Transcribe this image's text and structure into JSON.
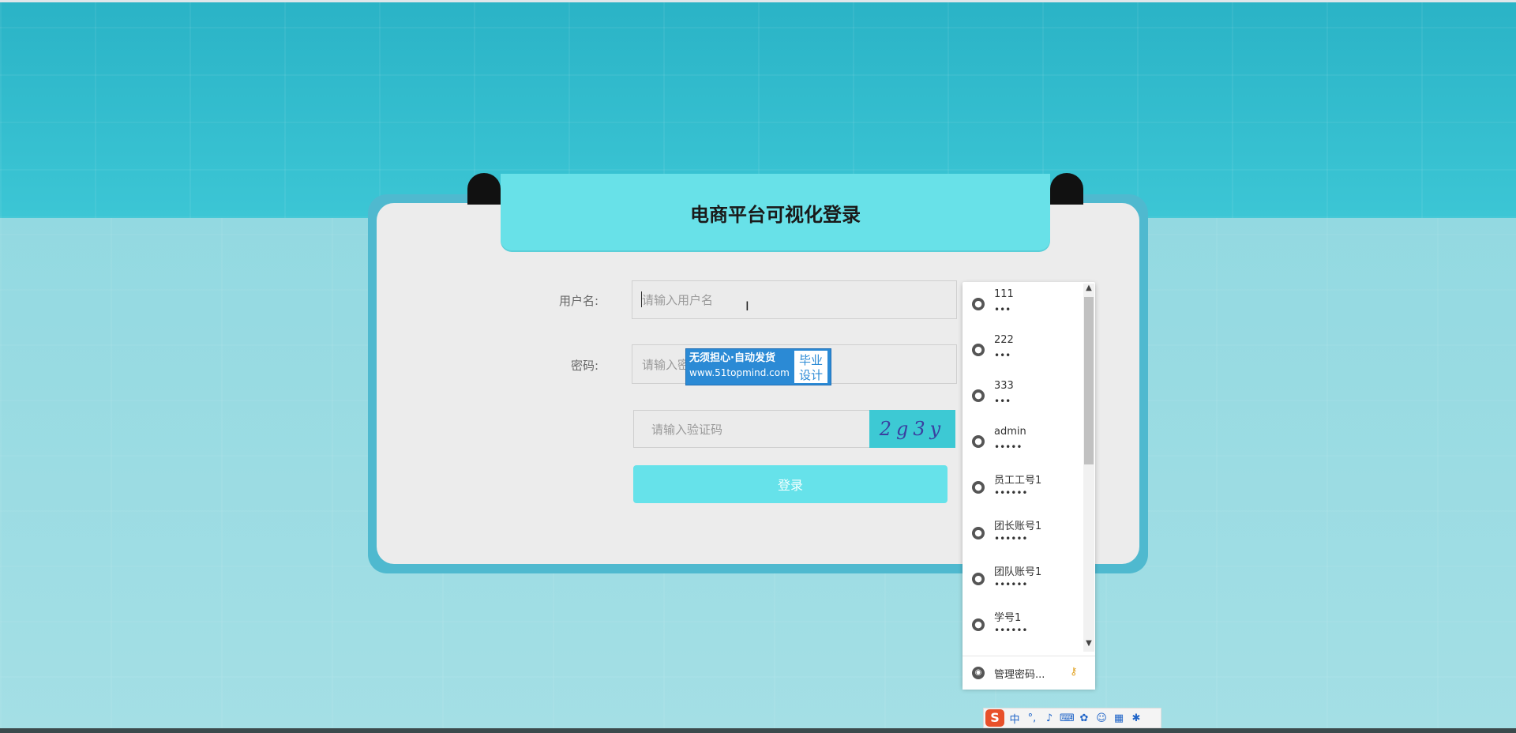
{
  "page": {
    "title": "电商平台可视化登录"
  },
  "form": {
    "username_label": "用户名:",
    "username_placeholder": "请输入用户名",
    "password_label": "密码:",
    "password_placeholder": "请输入密",
    "captcha_placeholder": "请输入验证码",
    "captcha_text": "2g3y",
    "login_label": "登录"
  },
  "watermark": {
    "line1": "无须担心·自动发货",
    "line2": "www.51topmind.com",
    "badge_top": "毕业",
    "badge_bottom": "设计"
  },
  "password_dropdown": {
    "items": [
      {
        "username": "111",
        "password_mask": "•••"
      },
      {
        "username": "222",
        "password_mask": "•••"
      },
      {
        "username": "333",
        "password_mask": "•••"
      },
      {
        "username": "admin",
        "password_mask": "•••••"
      },
      {
        "username": "员工工号1",
        "password_mask": "••••••"
      },
      {
        "username": "团长账号1",
        "password_mask": "••••••"
      },
      {
        "username": "团队账号1",
        "password_mask": "••••••"
      },
      {
        "username": "学号1",
        "password_mask": "••••••"
      }
    ],
    "manage_label": "管理密码..."
  },
  "ime_bar": {
    "logo": "S",
    "mode": "中",
    "icons": [
      "punctuation-icon",
      "microphone-icon",
      "keyboard-icon",
      "skin-icon",
      "robot-icon",
      "grid-icon",
      "settings-icon"
    ]
  },
  "colors": {
    "accent": "#68e1e8",
    "card_border": "#4fb9cf",
    "card_bg": "#ececec",
    "watermark_blue": "#2b8ad5"
  }
}
